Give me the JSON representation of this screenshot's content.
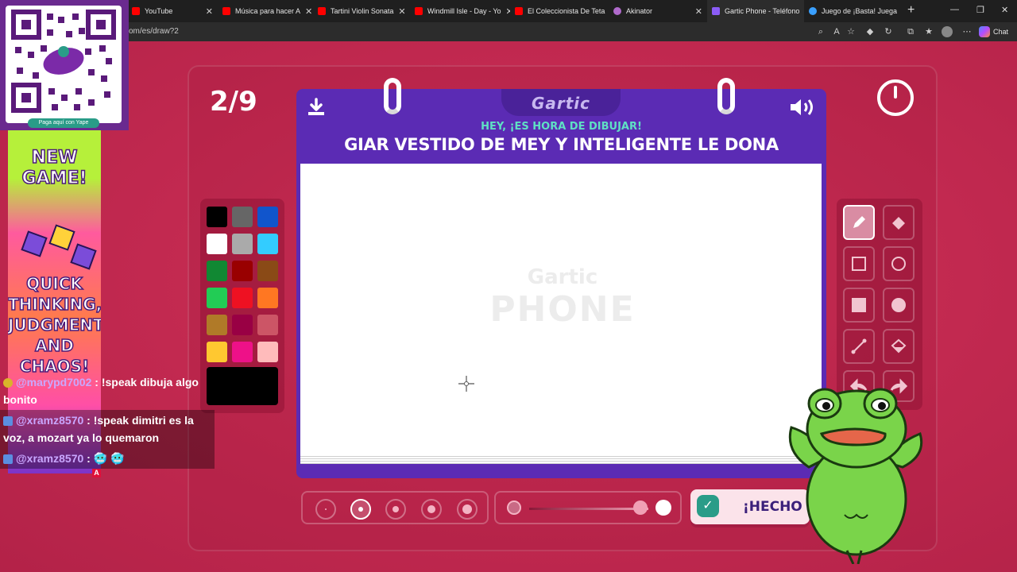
{
  "browser": {
    "tabs": [
      {
        "title": "YouTube",
        "color": "#ff0000",
        "active": false
      },
      {
        "title": "Música para hacer A",
        "color": "#ff0000",
        "active": false
      },
      {
        "title": "Tartini Violin Sonata",
        "color": "#ff0000",
        "active": false
      },
      {
        "title": "Windmill Isle - Day - Yo",
        "color": "#ff0000",
        "active": false
      },
      {
        "title": "El Coleccionista De Teta",
        "color": "#ff0000",
        "active": false
      },
      {
        "title": "Akinator",
        "color": "#b06acb",
        "active": false
      },
      {
        "title": "Gartic Phone - Teléfono",
        "color": "#8b5cf6",
        "active": true
      },
      {
        "title": "Juego de ¡Basta! Juega",
        "color": "#3aa0ff",
        "active": false
      }
    ],
    "url": "om/es/draw?2",
    "chat_label": "Chat"
  },
  "game": {
    "round": "2/9",
    "logo": "Gartic",
    "hint": "HEY, ¡ES HORA DE DIBUJAR!",
    "prompt": "GIAR VESTIDO DE MEY Y INTELIGENTE LE DONA",
    "watermark_top": "Gartic",
    "watermark_bottom": "PHONE",
    "done_label": "¡HECHO",
    "palette": [
      "#000000",
      "#666666",
      "#1155cc",
      "#ffffff",
      "#aaaaaa",
      "#33ccff",
      "#118833",
      "#990000",
      "#8a4a16",
      "#22cc55",
      "#ee1122",
      "#ff7722",
      "#b07a28",
      "#990044",
      "#cc5566",
      "#ffc830",
      "#ee1188",
      "#ffbbbb"
    ],
    "current_color": "#000000"
  },
  "overlay": {
    "qr_caption": "Paga aquí con Yape",
    "ad_line1": "NEW GAME!",
    "ad_line2": "QUICK THINKING, JUDGMENT AND CHAOS!",
    "chat": [
      {
        "user": "@marypd7002",
        "text": " : !speak dibuja algo bonito"
      },
      {
        "user": "@xramz8570",
        "text": " : !speak dimitri es la voz, a mozart ya lo quemaron"
      },
      {
        "user": "@xramz8570",
        "text": " : 🥶 🥶"
      }
    ],
    "badge": "A"
  }
}
